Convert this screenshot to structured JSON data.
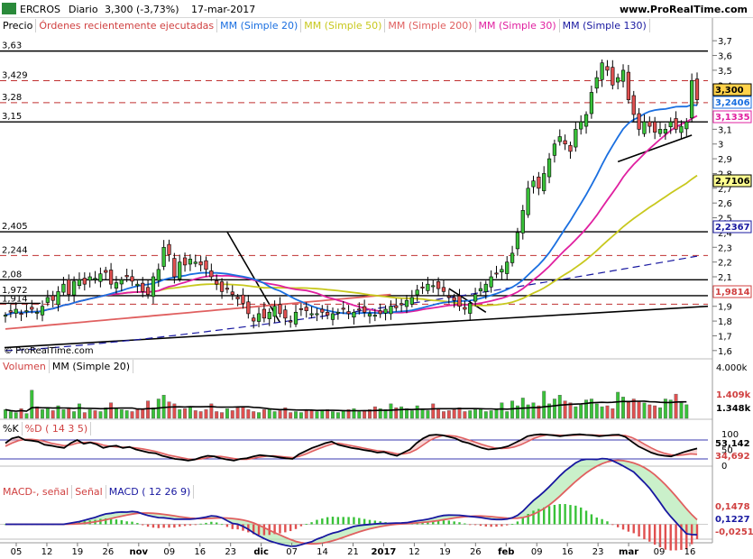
{
  "header": {
    "ticker": "ERCROS",
    "period": "Diario",
    "quote": "3,300 (-3,73%)",
    "date": "17-mar-2017",
    "site": "www.ProRealTime.com",
    "logo_text": "© ProRealTime.com"
  },
  "price_panel": {
    "legend": [
      {
        "label": "Precio",
        "color": "#000000"
      },
      {
        "label": "Órdenes recientemente ejecutadas",
        "color": "#d04040"
      },
      {
        "label": "MM (Simple 20)",
        "color": "#1a6fe0"
      },
      {
        "label": "MM (Simple 50)",
        "color": "#c8c81e"
      },
      {
        "label": "MM (Simple 200)",
        "color": "#e06060"
      },
      {
        "label": "MM (Simple 30)",
        "color": "#e020a0"
      },
      {
        "label": "MM (Simple 130)",
        "color": "#1818a0"
      }
    ],
    "level_labels": [
      "3,63",
      "3,429",
      "3,28",
      "3,15",
      "2,405",
      "2,244",
      "2,08",
      "1,972",
      "1,914"
    ],
    "y_ticks": [
      "3,7",
      "3,6",
      "3,5",
      "3,4",
      "3,3",
      "3,2",
      "3,1",
      "3",
      "2,9",
      "2,8",
      "2,7",
      "2,6",
      "2,5",
      "2,4",
      "2,3",
      "2,2",
      "2,1",
      "2",
      "1,9",
      "1,8",
      "1,7",
      "1,6"
    ],
    "value_tags": [
      {
        "text": "3,300",
        "color": "#000000",
        "bg": "#ffd24a"
      },
      {
        "text": "3,2406",
        "color": "#1a6fe0",
        "bg": "#ffffff"
      },
      {
        "text": "3,1335",
        "color": "#e020a0",
        "bg": "#ffffff"
      },
      {
        "text": "2,7106",
        "color": "#000000",
        "bg": "#ffff90"
      },
      {
        "text": "2,2367",
        "color": "#1818a0",
        "bg": "#ffffff"
      },
      {
        "text": "1,9814",
        "color": "#d04040",
        "bg": "#ffffff"
      }
    ]
  },
  "volume_panel": {
    "legend": [
      {
        "label": "Volumen",
        "color": "#d04040"
      },
      {
        "label": "MM (Simple 20)",
        "color": "#000000"
      }
    ],
    "y_ticks": [
      "4.000k"
    ],
    "value_tags": [
      {
        "text": "1.409k",
        "color": "#d04040"
      },
      {
        "text": "1.348k",
        "color": "#000000"
      }
    ]
  },
  "stoch_panel": {
    "legend": [
      {
        "label": "%K",
        "color": "#000000"
      },
      {
        "label": "%D ( 14 3 5)",
        "color": "#d04040"
      }
    ],
    "y_ticks": [
      "100",
      "50",
      "0"
    ],
    "value_tags": [
      {
        "text": "53,142",
        "color": "#000000"
      },
      {
        "text": "34,692",
        "color": "#d04040"
      }
    ]
  },
  "macd_panel": {
    "legend": [
      {
        "label": "MACD-, señal",
        "color": "#d04040"
      },
      {
        "label": "Señal",
        "color": "#d04040"
      },
      {
        "label": "MACD ( 12 26 9)",
        "color": "#1818a0"
      }
    ],
    "value_tags": [
      {
        "text": "0,1478",
        "color": "#d04040"
      },
      {
        "text": "0,1227",
        "color": "#1818a0"
      },
      {
        "text": "-0,0251",
        "color": "#d04040"
      }
    ]
  },
  "x_axis": {
    "labels": [
      "05",
      "12",
      "19",
      "26",
      "nov",
      "09",
      "16",
      "23",
      "dic",
      "07",
      "14",
      "21",
      "2017",
      "12",
      "19",
      "26",
      "feb",
      "09",
      "16",
      "23",
      "mar",
      "09",
      "16"
    ]
  },
  "chart_data": {
    "type": "candlestick",
    "title": "ERCROS Diario",
    "x_ticks": [
      "05",
      "12",
      "19",
      "26",
      "nov",
      "09",
      "16",
      "23",
      "dic",
      "07",
      "14",
      "21",
      "2017",
      "12",
      "19",
      "26",
      "feb",
      "09",
      "16",
      "23",
      "mar",
      "09",
      "16"
    ],
    "ylim": [
      1.55,
      3.75
    ],
    "horizontal_levels": [
      3.63,
      3.429,
      3.28,
      3.15,
      2.405,
      2.244,
      2.08,
      1.972,
      1.914
    ],
    "close": [
      1.84,
      1.86,
      1.88,
      1.85,
      1.87,
      1.88,
      1.86,
      1.9,
      1.96,
      1.94,
      2.0,
      2.05,
      1.98,
      2.07,
      2.08,
      2.05,
      2.1,
      2.09,
      2.12,
      2.13,
      2.05,
      2.06,
      2.08,
      2.1,
      2.07,
      2.05,
      2.0,
      1.98,
      2.1,
      2.15,
      2.3,
      2.25,
      2.1,
      2.2,
      2.18,
      2.22,
      2.2,
      2.18,
      2.15,
      2.1,
      2.05,
      2.0,
      2.02,
      1.98,
      1.95,
      1.92,
      1.85,
      1.8,
      1.85,
      1.82,
      1.86,
      1.9,
      1.85,
      1.82,
      1.8,
      1.86,
      1.88,
      1.87,
      1.85,
      1.85,
      1.86,
      1.84,
      1.85,
      1.86,
      1.88,
      1.85,
      1.86,
      1.88,
      1.86,
      1.85,
      1.84,
      1.85,
      1.88,
      1.9,
      1.89,
      1.91,
      1.94,
      1.96,
      2.01,
      2.03,
      2.05,
      2.04,
      2.02,
      2.0,
      1.96,
      1.94,
      1.9,
      1.88,
      1.92,
      1.98,
      2.02,
      2.05,
      2.1,
      2.12,
      2.15,
      2.2,
      2.26,
      2.4,
      2.55,
      2.7,
      2.75,
      2.7,
      2.8,
      2.9,
      3.0,
      3.05,
      3.0,
      2.95,
      3.1,
      3.15,
      3.2,
      3.35,
      3.45,
      3.55,
      3.5,
      3.4,
      3.45,
      3.5,
      3.3,
      3.2,
      3.1,
      3.15,
      3.12,
      3.08,
      3.1,
      3.1,
      3.15,
      3.1,
      3.12,
      3.15,
      3.43,
      3.3
    ],
    "volume": [
      900,
      700,
      600,
      1000,
      500,
      2900,
      1200,
      900,
      1100,
      800,
      1300,
      900,
      1000,
      700,
      1500,
      600,
      900,
      800,
      700,
      1100,
      1600,
      1000,
      900,
      800,
      700,
      900,
      1000,
      1800,
      1100,
      2000,
      2400,
      1700,
      1500,
      900,
      1000,
      1200,
      800,
      700,
      900,
      1500,
      700,
      600,
      1000,
      800,
      1100,
      1200,
      900,
      700,
      600,
      900,
      1000,
      700,
      800,
      1100,
      600,
      700,
      600,
      900,
      800,
      700,
      800,
      900,
      700,
      600,
      800,
      900,
      1000,
      700,
      800,
      900,
      1200,
      1000,
      900,
      1500,
      1100,
      1200,
      1000,
      800,
      1300,
      900,
      800,
      1500,
      1000,
      700,
      800,
      900,
      1100,
      700,
      800,
      900,
      1000,
      700,
      800,
      900,
      1600,
      700,
      1800,
      1300,
      2100,
      1400,
      1600,
      1300,
      2800,
      1500,
      2000,
      2400,
      1800,
      1600,
      1200,
      1400,
      1900,
      2000,
      1500,
      1200,
      1300,
      1000,
      2700,
      2200,
      1800,
      2000,
      1700,
      1600,
      1400,
      1300,
      1100,
      2000,
      1900,
      2500,
      1600,
      1409
    ],
    "stoch_k": [
      70,
      85,
      90,
      80,
      78,
      75,
      65,
      62,
      58,
      55,
      70,
      80,
      68,
      72,
      66,
      55,
      60,
      62,
      55,
      58,
      50,
      45,
      40,
      38,
      30,
      25,
      20,
      18,
      15,
      18,
      25,
      30,
      28,
      22,
      18,
      15,
      20,
      22,
      28,
      32,
      30,
      28,
      25,
      22,
      20,
      35,
      45,
      55,
      62,
      70,
      75,
      65,
      60,
      55,
      52,
      48,
      45,
      40,
      42,
      35,
      30,
      40,
      50,
      70,
      85,
      95,
      97,
      95,
      90,
      85,
      75,
      70,
      62,
      55,
      50,
      52,
      55,
      60,
      70,
      80,
      92,
      96,
      98,
      97,
      95,
      92,
      95,
      97,
      98,
      96,
      95,
      92,
      94,
      96,
      97,
      90,
      75,
      60,
      50,
      40,
      33,
      30,
      28,
      35,
      42,
      48,
      53
    ],
    "stoch_d": [
      60,
      70,
      78,
      82,
      82,
      80,
      76,
      70,
      66,
      62,
      64,
      70,
      72,
      73,
      70,
      64,
      60,
      58,
      57,
      57,
      55,
      52,
      48,
      44,
      38,
      32,
      28,
      24,
      20,
      18,
      20,
      24,
      28,
      28,
      25,
      21,
      19,
      19,
      22,
      26,
      29,
      30,
      28,
      26,
      24,
      28,
      35,
      44,
      52,
      60,
      67,
      70,
      66,
      62,
      58,
      54,
      50,
      46,
      44,
      41,
      36,
      36,
      40,
      50,
      64,
      78,
      88,
      94,
      94,
      92,
      87,
      80,
      73,
      66,
      60,
      55,
      53,
      54,
      58,
      65,
      75,
      85,
      92,
      96,
      96,
      95,
      94,
      95,
      96,
      96,
      96,
      95,
      94,
      94,
      95,
      94,
      88,
      78,
      66,
      55,
      45,
      38,
      33,
      31,
      33,
      36,
      34.692
    ]
  }
}
